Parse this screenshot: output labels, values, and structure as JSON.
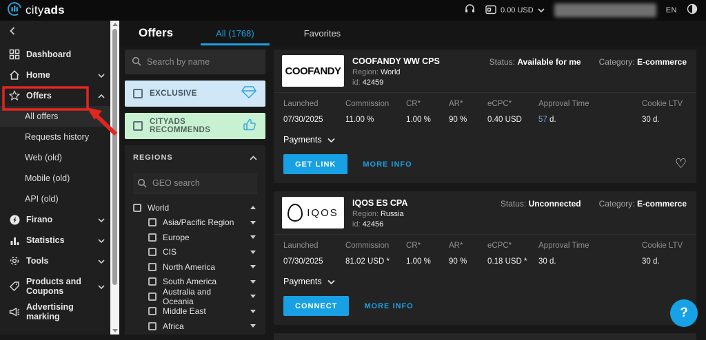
{
  "topbar": {
    "logo_light": "city",
    "logo_bold": "ads",
    "balance": "0.00 USD",
    "language": "EN"
  },
  "sidebar": {
    "items": [
      "Dashboard",
      "Home",
      "Offers",
      "All offers",
      "Requests history",
      "Web (old)",
      "Mobile (old)",
      "API (old)",
      "Firano",
      "Statistics",
      "Tools",
      "Products and Coupons",
      "Advertising marking"
    ]
  },
  "header": {
    "title": "Offers",
    "tab_all": "All (1768)",
    "tab_favorites": "Favorites"
  },
  "filters": {
    "search_placeholder": "Search by name",
    "exclusive_label": "EXCLUSIVE",
    "recommends_label": "CITYADS RECOMMENDS",
    "regions_title": "REGIONS",
    "geo_placeholder": "GEO search",
    "world_label": "World",
    "regions": [
      "Asia/Pacific Region",
      "Europe",
      "CIS",
      "North America",
      "South America",
      "Australia and Oceania",
      "Middle East",
      "Africa"
    ]
  },
  "offers": {
    "columns": [
      "Launched",
      "Commission",
      "CR*",
      "AR*",
      "eCPC*",
      "Approval Time",
      "Cookie LTV"
    ],
    "payments_label": "Payments",
    "more_info_label": "MORE INFO",
    "cards": [
      {
        "logo_text": "COOFANDY",
        "title": "COOFANDY WW CPS",
        "region_label": "Region:",
        "region": "World",
        "id_label": "id:",
        "id": "42459",
        "status_label": "Status:",
        "status": "Available for me",
        "category_label": "Category:",
        "category": "E-commerce",
        "stats": {
          "launched": "07/30/2025",
          "commission": "11.00 %",
          "cr": "1.00 %",
          "ar": "90 %",
          "ecpc": "0.40 USD",
          "approval_accent": "57",
          "approval_suffix": " d.",
          "cookie_ltv": "30 d."
        },
        "action_label": "GET LINK"
      },
      {
        "logo_text": "IQOS",
        "title": "IQOS ES CPA",
        "region_label": "Region:",
        "region": "Russia",
        "id_label": "id:",
        "id": "42456",
        "status_label": "Status:",
        "status": "Unconnected",
        "category_label": "Category:",
        "category": "E-commerce",
        "stats": {
          "launched": "07/30/2025",
          "commission": "81.02 USD *",
          "cr": "1.00 %",
          "ar": "90 %",
          "ecpc": "0.18 USD *",
          "approval": "30 d.",
          "cookie_ltv": "30 d."
        },
        "action_label": "CONNECT"
      }
    ]
  },
  "help": {
    "label": "?"
  },
  "colors": {
    "accent_blue": "#1ca0e3",
    "annotation_red": "#e3251f",
    "exclusive_bg": "#cfe7f7",
    "recommends_bg": "#c8f1d2"
  }
}
